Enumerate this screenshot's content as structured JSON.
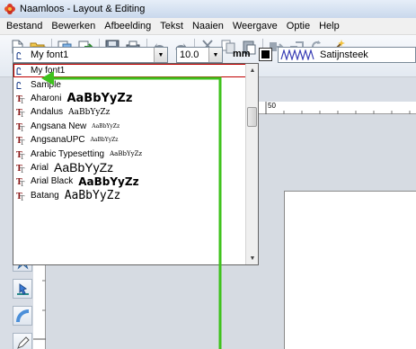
{
  "window": {
    "title": "Naamloos - Layout & Editing"
  },
  "menu": [
    "Bestand",
    "Bewerken",
    "Afbeelding",
    "Tekst",
    "Naaien",
    "Weergave",
    "Optie",
    "Help"
  ],
  "toolbar": {
    "icons": [
      "new-icon",
      "open-icon",
      "import-icon",
      "export-icon",
      "save-icon",
      "print-icon",
      "undo-icon",
      "redo-icon",
      "cut-icon",
      "copy-icon",
      "paste-icon",
      "duplicate-icon",
      "transfer-icon",
      "rotate-icon",
      "wizard-icon"
    ]
  },
  "font_select": {
    "value": "My font1"
  },
  "size_select": {
    "value": "10.0"
  },
  "unit": "mm",
  "stitch": {
    "label": "Satijnsteek"
  },
  "ruler": {
    "top_label": "50"
  },
  "font_list": [
    {
      "icon": "user-font-icon",
      "name": "My font1",
      "preview": ""
    },
    {
      "icon": "user-font-icon",
      "name": "Sample",
      "preview": ""
    },
    {
      "icon": "truetype-icon",
      "name": "Aharoni",
      "preview": "AaBbYyZz"
    },
    {
      "icon": "truetype-icon",
      "name": "Andalus",
      "preview": "AaBbYyZz"
    },
    {
      "icon": "truetype-icon",
      "name": "Angsana New",
      "preview": "AaBbYyZz"
    },
    {
      "icon": "truetype-icon",
      "name": "AngsanaUPC",
      "preview": "AaBbYyZz"
    },
    {
      "icon": "truetype-icon",
      "name": "Arabic Typesetting",
      "preview": "AaBbYyZz"
    },
    {
      "icon": "truetype-icon",
      "name": "Arial",
      "preview": "AaBbYyZz"
    },
    {
      "icon": "truetype-icon",
      "name": "Arial Black",
      "preview": "AaBbYyZz"
    },
    {
      "icon": "truetype-icon",
      "name": "Batang",
      "preview": "AaBbYyZz"
    }
  ],
  "left_tools": [
    "star-shape-tool-icon",
    "select-tool-icon",
    "arc-tool-icon",
    "pencil-tool-icon"
  ],
  "colors": {
    "annotation": "#3ec21c",
    "selected_outline": "#c00000"
  }
}
